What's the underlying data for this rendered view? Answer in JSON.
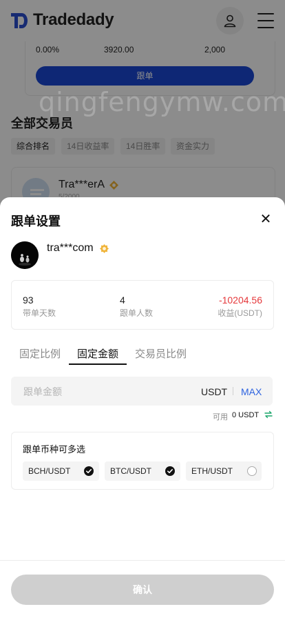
{
  "header": {
    "brand": "Tradedady"
  },
  "background_card": {
    "stats": [
      "0.00%",
      "3920.00",
      "2,000"
    ],
    "follow_label": "跟单"
  },
  "traders_section": {
    "title": "全部交易员",
    "filters": [
      "综合排名",
      "14日收益率",
      "14日胜率",
      "资金实力"
    ],
    "first_trader": {
      "name": "Tra***erA",
      "sub": "5/2000"
    }
  },
  "sheet": {
    "title": "跟单设置",
    "close_glyph": "✕",
    "profile": {
      "name": "tra***com"
    },
    "stats": [
      {
        "value": "93",
        "label": "带单天数"
      },
      {
        "value": "4",
        "label": "跟单人数"
      },
      {
        "value": "-10204.56",
        "label": "收益(USDT)"
      }
    ],
    "tabs": [
      "固定比例",
      "固定金额",
      "交易员比例"
    ],
    "active_tab": "固定金额",
    "amount": {
      "placeholder": "跟单金额",
      "value": "",
      "unit": "USDT",
      "max_label": "MAX"
    },
    "available": {
      "label": "可用",
      "value": "0 USDT"
    },
    "coins": {
      "title": "跟单币种可多选",
      "items": [
        {
          "label": "BCH/USDT",
          "checked": true
        },
        {
          "label": "BTC/USDT",
          "checked": true
        },
        {
          "label": "ETH/USDT",
          "checked": false
        }
      ]
    },
    "confirm_label": "确认",
    "watermark": "qingfengymw.com"
  },
  "colors": {
    "brand_blue": "#1a47d6",
    "negative": "#e5383b",
    "max_blue": "#2d63e0",
    "swap_green": "#1aa56a"
  }
}
